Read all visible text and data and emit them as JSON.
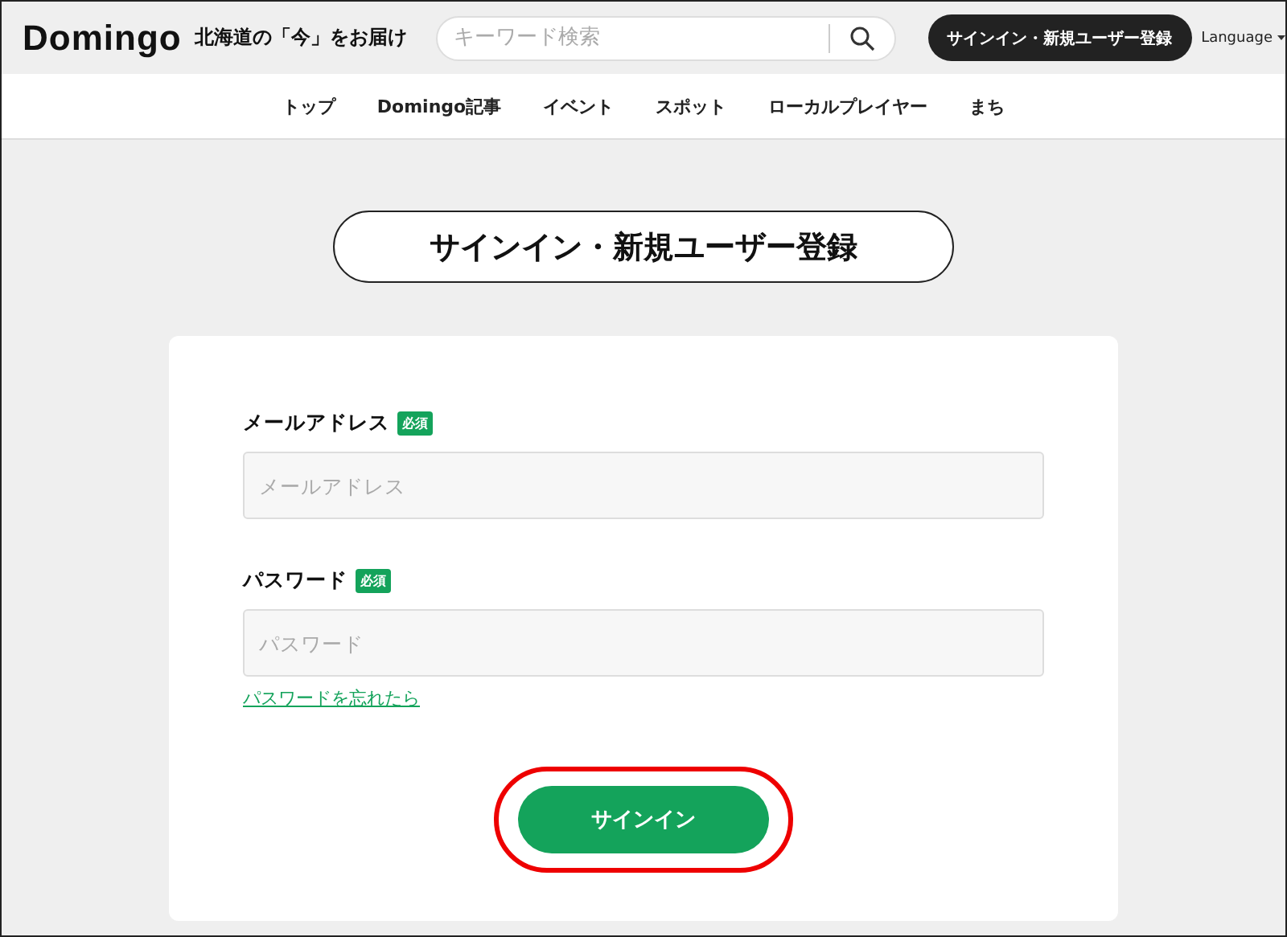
{
  "header": {
    "logo": "Domingo",
    "tagline": "北海道の「今」をお届け",
    "search": {
      "placeholder": "キーワード検索"
    },
    "signin_button": "サインイン・新規ユーザー登録",
    "language": "Language"
  },
  "nav": [
    {
      "label": "トップ"
    },
    {
      "label": "Domingo記事"
    },
    {
      "label": "イベント"
    },
    {
      "label": "スポット"
    },
    {
      "label": "ローカルプレイヤー"
    },
    {
      "label": "まち"
    }
  ],
  "page_title": "サインイン・新規ユーザー登録",
  "form": {
    "fields": [
      {
        "label": "メールアドレス",
        "badge": "必須",
        "placeholder": "メールアドレス"
      },
      {
        "label": "パスワード",
        "badge": "必須",
        "placeholder": "パスワード"
      }
    ],
    "forgot_link": "パスワードを忘れたら",
    "submit": "サインイン",
    "submit_highlighted": true
  }
}
